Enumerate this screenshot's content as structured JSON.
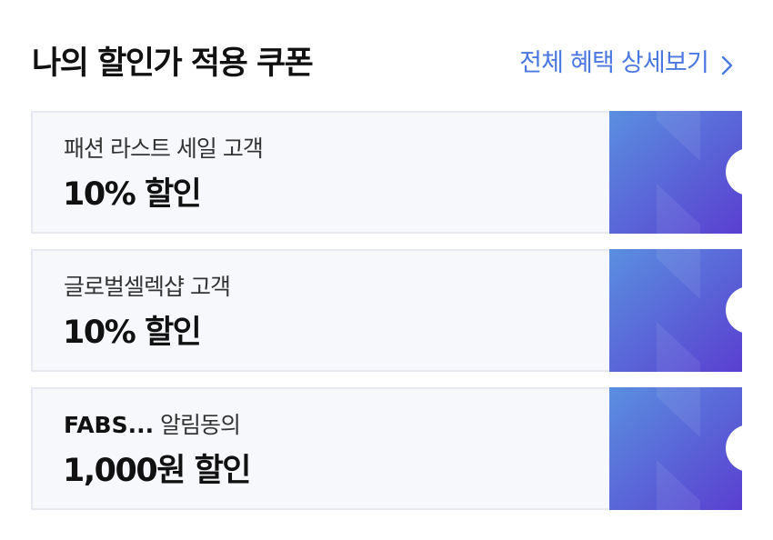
{
  "header": {
    "title": "나의 할인가 적용 쿠폰",
    "see_all_label": "전체 혜택 상세보기"
  },
  "coupons": [
    {
      "desc_bold": "",
      "desc": "패션 라스트 세일 고객",
      "amount": "10% 할인"
    },
    {
      "desc_bold": "",
      "desc": "글로벌셀렉샵 고객",
      "amount": "10% 할인"
    },
    {
      "desc_bold": "FABS...",
      "desc": " 알림동의",
      "amount": "1,000원 할인"
    }
  ],
  "colors": {
    "accent_link": "#4a78e0",
    "stub_gradient_start": "#5a8fe0",
    "stub_gradient_end": "#5a3fd0"
  },
  "icons": {
    "see_all": "chevron-right-icon",
    "stub": "coupon-stub-graphic"
  }
}
